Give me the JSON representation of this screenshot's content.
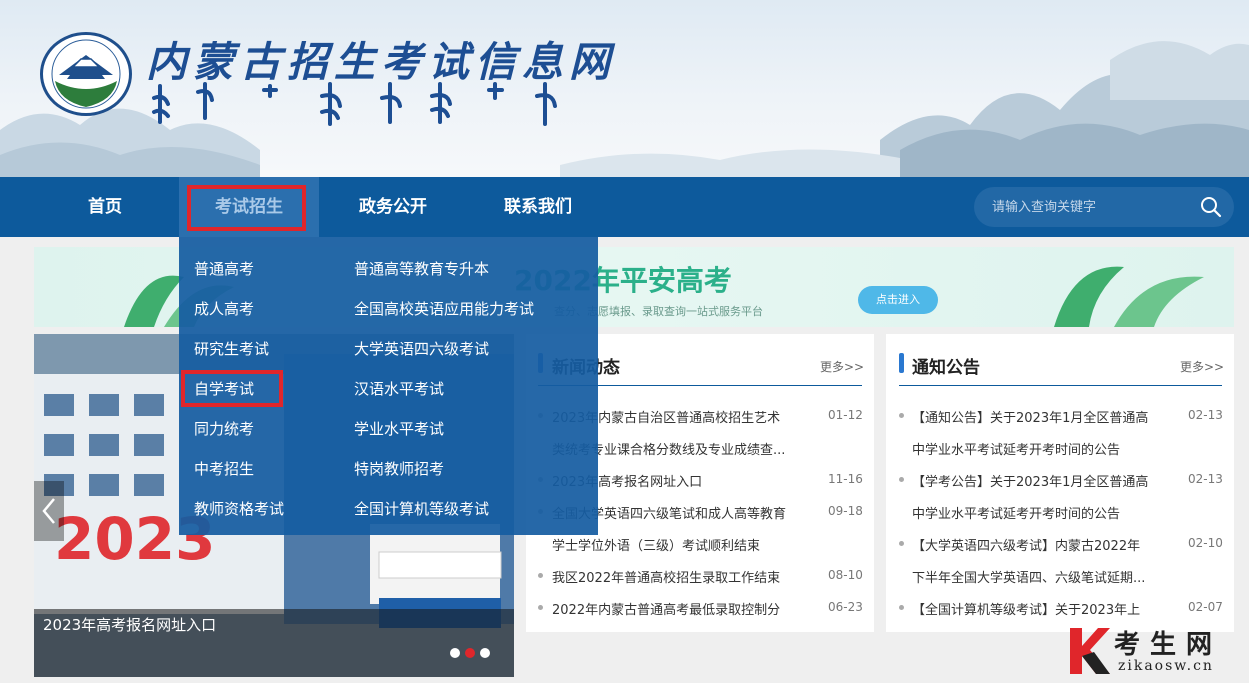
{
  "header": {
    "site_title": "内蒙古招生考试信息网"
  },
  "nav": {
    "items": [
      {
        "label": "首页"
      },
      {
        "label": "考试招生"
      },
      {
        "label": "政务公开"
      },
      {
        "label": "联系我们"
      }
    ],
    "search_placeholder": "请输入查询关键字"
  },
  "dropdown": {
    "left": [
      "普通高考",
      "成人高考",
      "研究生考试",
      "自学考试",
      "同力统考",
      "中考招生",
      "教师资格考试"
    ],
    "right": [
      "普通高等教育专升本",
      "全国高校英语应用能力考试",
      "大学英语四六级考试",
      "汉语水平考试",
      "学业水平考试",
      "特岗教师招考",
      "全国计算机等级考试"
    ]
  },
  "banner": {
    "title": "2022年平安高考",
    "subtitle": "查分、志愿填报、录取查询一站式服务平台",
    "button": "点击进入"
  },
  "slider": {
    "caption": "2023年高考报名网址入口"
  },
  "news": {
    "title": "新闻动态",
    "more": "更多>>",
    "items": [
      {
        "line1": "2023年内蒙古自治区普通高校招生艺术",
        "line2": "类统考专业课合格分数线及专业成绩查...",
        "date": "01-12"
      },
      {
        "line1": "2023年高考报名网址入口",
        "line2": "",
        "date": "11-16"
      },
      {
        "line1": "全国大学英语四六级笔试和成人高等教育",
        "line2": "学士学位外语（三级）考试顺利结束",
        "date": "09-18"
      },
      {
        "line1": "我区2022年普通高校招生录取工作结束",
        "line2": "",
        "date": "08-10"
      },
      {
        "line1": "2022年内蒙古普通高考最低录取控制分",
        "line2": "",
        "date": "06-23"
      }
    ]
  },
  "notice": {
    "title": "通知公告",
    "more": "更多>>",
    "items": [
      {
        "line1": "【通知公告】关于2023年1月全区普通高",
        "line2": "中学业水平考试延考开考时间的公告",
        "date": "02-13"
      },
      {
        "line1": "【学考公告】关于2023年1月全区普通高",
        "line2": "中学业水平考试延考开考时间的公告",
        "date": "02-13"
      },
      {
        "line1": "【大学英语四六级考试】内蒙古2022年",
        "line2": "下半年全国大学英语四、六级笔试延期...",
        "date": "02-10"
      },
      {
        "line1": "【全国计算机等级考试】关于2023年上",
        "line2": "",
        "date": "02-07"
      }
    ]
  },
  "watermark": {
    "brand": "考生网",
    "domain": "zikaosw.cn"
  },
  "colors": {
    "nav_bg": "#0d5a9c",
    "accent_red": "#e0262b",
    "title_blue": "#1d4e93"
  }
}
